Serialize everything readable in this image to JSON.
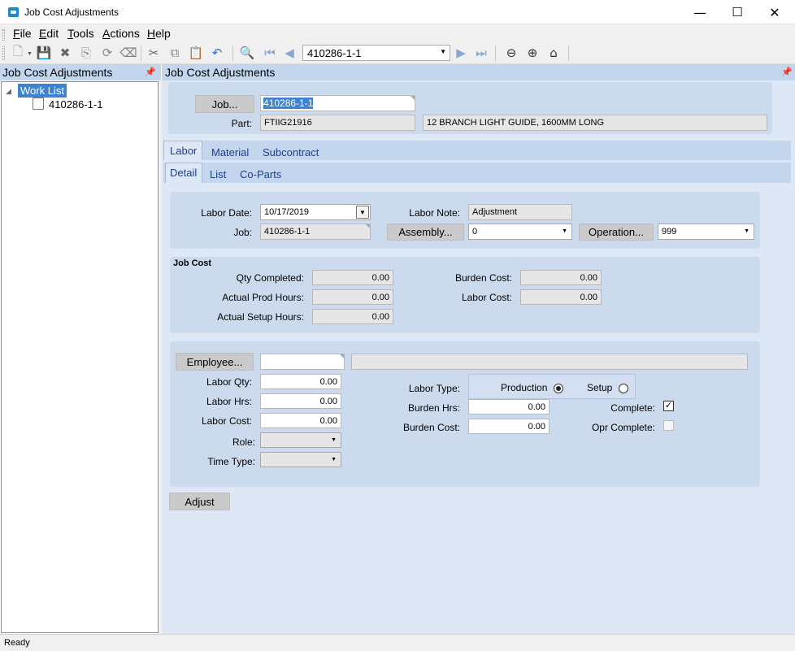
{
  "window": {
    "title": "Job Cost Adjustments",
    "minimize": "—",
    "maximize": "☐",
    "close": "✕"
  },
  "menu": [
    {
      "key": "F",
      "rest": "ile"
    },
    {
      "key": "E",
      "rest": "dit"
    },
    {
      "key": "T",
      "rest": "ools"
    },
    {
      "key": "A",
      "rest": "ctions"
    },
    {
      "key": "H",
      "rest": "elp"
    }
  ],
  "toolbar": {
    "nav_value": "410286-1-1"
  },
  "left": {
    "header": "Job Cost Adjustments",
    "root": "Work List",
    "item": "410286-1-1"
  },
  "main": {
    "header": "Job Cost Adjustments",
    "job_button": "Job...",
    "job_value": "410286-1-1",
    "part_label": "Part:",
    "part_num": "FTIIG21916",
    "part_desc": "12 BRANCH LIGHT GUIDE, 1600MM LONG",
    "tabs": [
      "Labor",
      "Material",
      "Subcontract"
    ],
    "subtabs": [
      "Detail",
      "List",
      "Co-Parts"
    ]
  },
  "labor": {
    "date_label": "Labor Date:",
    "date": "10/17/2019",
    "note_label": "Labor Note:",
    "note": "Adjustment",
    "job_label": "Job:",
    "job": "410286-1-1",
    "assembly_button": "Assembly...",
    "assembly": "0",
    "operation_button": "Operation...",
    "operation": "999"
  },
  "jobcost": {
    "title": "Job Cost",
    "qty_label": "Qty Completed:",
    "qty": "0.00",
    "prod_label": "Actual Prod Hours:",
    "prod": "0.00",
    "setup_label": "Actual Setup Hours:",
    "setup": "0.00",
    "burden_label": "Burden Cost:",
    "burden": "0.00",
    "labor_label": "Labor Cost:",
    "labor": "0.00"
  },
  "employee": {
    "button": "Employee...",
    "id": "",
    "name": "",
    "qty_label": "Labor Qty:",
    "qty": "0.00",
    "hrs_label": "Labor Hrs:",
    "hrs": "0.00",
    "cost_label": "Labor Cost:",
    "cost": "0.00",
    "role_label": "Role:",
    "role": "",
    "time_label": "Time Type:",
    "time": "",
    "type_label": "Labor Type:",
    "production": "Production",
    "setup": "Setup",
    "bhrs_label": "Burden Hrs:",
    "bhrs": "0.00",
    "bcost_label": "Burden Cost:",
    "bcost": "0.00",
    "complete_label": "Complete:",
    "complete_mark": "✓",
    "opr_label": "Opr Complete:"
  },
  "adjust_button": "Adjust",
  "status": "Ready"
}
